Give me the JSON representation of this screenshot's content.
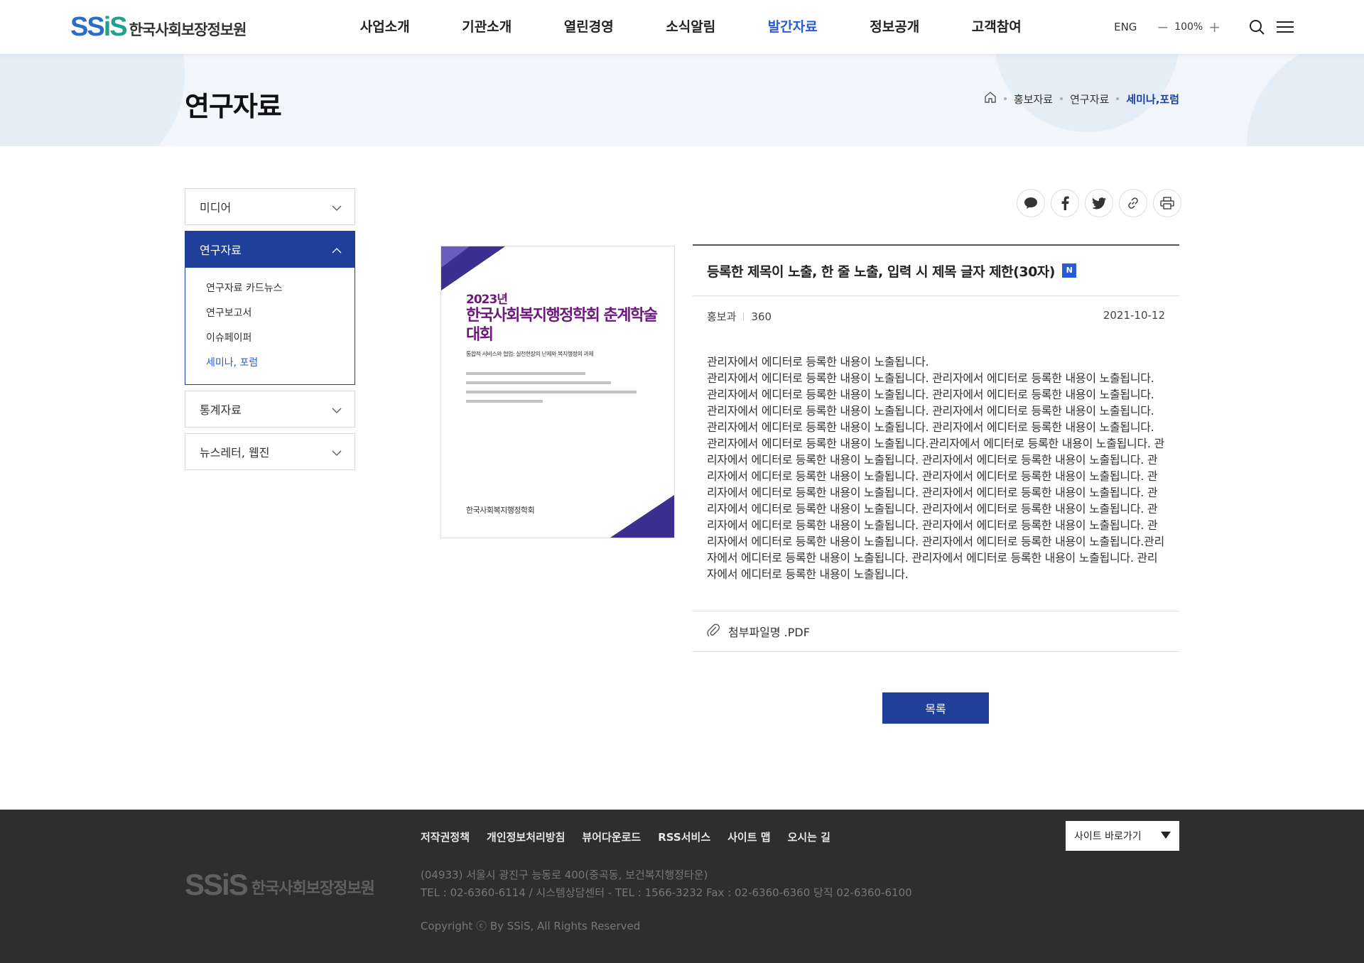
{
  "header": {
    "logo_mark_1": "SS",
    "logo_mark_2": "iS",
    "logo_text": "한국사회보장정보원",
    "nav": [
      "사업소개",
      "기관소개",
      "열린경영",
      "소식알림",
      "발간자료",
      "정보공개",
      "고객참여"
    ],
    "active_nav": "발간자료",
    "lang": "ENG",
    "zoom_minus": "−",
    "zoom": "100%",
    "zoom_plus": "+"
  },
  "visual": {
    "page_title": "연구자료",
    "breadcrumb": [
      "홍보자료",
      "연구자료",
      "세미나,포럼"
    ]
  },
  "lnb": {
    "items": [
      {
        "label": "미디어",
        "state": "closed"
      },
      {
        "label": "연구자료",
        "state": "open"
      },
      {
        "label": "통계자료",
        "state": "closed"
      },
      {
        "label": "뉴스레터, 웹진",
        "state": "closed"
      }
    ],
    "sub_items": [
      "연구자료 카드뉴스",
      "연구보고서",
      "이슈페이퍼",
      "세미나, 포럼"
    ],
    "current_sub": "세미나, 포럼"
  },
  "share_icons": [
    "talk-icon",
    "facebook-icon",
    "twitter-icon",
    "link-icon",
    "print-icon"
  ],
  "thumbnail": {
    "year": "2023년",
    "title": "한국사회복지행정학회 춘계학술대회",
    "subtitle": "통합적 서비스와 협업: 실천현장의 난제와 복지행정의 과제",
    "org": "한국사회복지행정학회"
  },
  "article": {
    "title": "등록한 제목이 노출, 한 줄 노출, 입력 시 제목 글자 제한(30자)",
    "new_badge": "N",
    "department": "홍보과",
    "views": "360",
    "date": "2021-10-12",
    "body_line1": "관리자에서 에디터로 등록한 내용이 노출됩니다.",
    "body": "관리자에서 에디터로 등록한 내용이 노출됩니다. 관리자에서 에디터로 등록한 내용이 노출됩니다. 관리자에서 에디터로 등록한 내용이 노출됩니다. 관리자에서 에디터로 등록한 내용이 노출됩니다. 관리자에서 에디터로 등록한 내용이 노출됩니다. 관리자에서 에디터로 등록한 내용이 노출됩니다. 관리자에서 에디터로 등록한 내용이 노출됩니다. 관리자에서 에디터로 등록한 내용이 노출됩니다.  관리자에서 에디터로 등록한 내용이 노출됩니다.관리자에서 에디터로 등록한 내용이 노출됩니다. 관리자에서 에디터로 등록한 내용이 노출됩니다. 관리자에서 에디터로 등록한 내용이 노출됩니다. 관리자에서 에디터로 등록한 내용이 노출됩니다. 관리자에서 에디터로 등록한 내용이 노출됩니다. 관리자에서 에디터로 등록한 내용이 노출됩니다. 관리자에서 에디터로 등록한 내용이 노출됩니다. 관리자에서 에디터로 등록한 내용이 노출됩니다. 관리자에서 에디터로 등록한 내용이 노출됩니다. 관리자에서 에디터로 등록한 내용이 노출됩니다. 관리자에서 에디터로 등록한 내용이 노출됩니다. 관리자에서 에디터로 등록한 내용이 노출됩니다.  관리자에서 에디터로 등록한 내용이 노출됩니다.관리자에서 에디터로 등록한 내용이 노출됩니다. 관리자에서 에디터로 등록한 내용이 노출됩니다. 관리자에서 에디터로 등록한 내용이 노출됩니다.",
    "attachment": "첨부파일명 .PDF",
    "list_button": "목록"
  },
  "footer": {
    "links": [
      "저작권정책",
      "개인정보처리방침",
      "뷰어다운로드",
      "RSS서비스",
      "사이트 맵",
      "오시는 길"
    ],
    "site_select": "사이트 바로가기",
    "logo_mark": "SSiS",
    "logo_text": "한국사회보장정보원",
    "address": "(04933) 서울시 광진구 능동로 400(중곡동, 보건복지행정타운)",
    "tel": "TEL :  02-6360-6114 / 시스템상담센터 - TEL : 1566-3232  Fax :  02-6360-6360  당직 02-6360-6100",
    "copyright": "Copyright ⓒ By SSiS, All Rights Reserved"
  }
}
